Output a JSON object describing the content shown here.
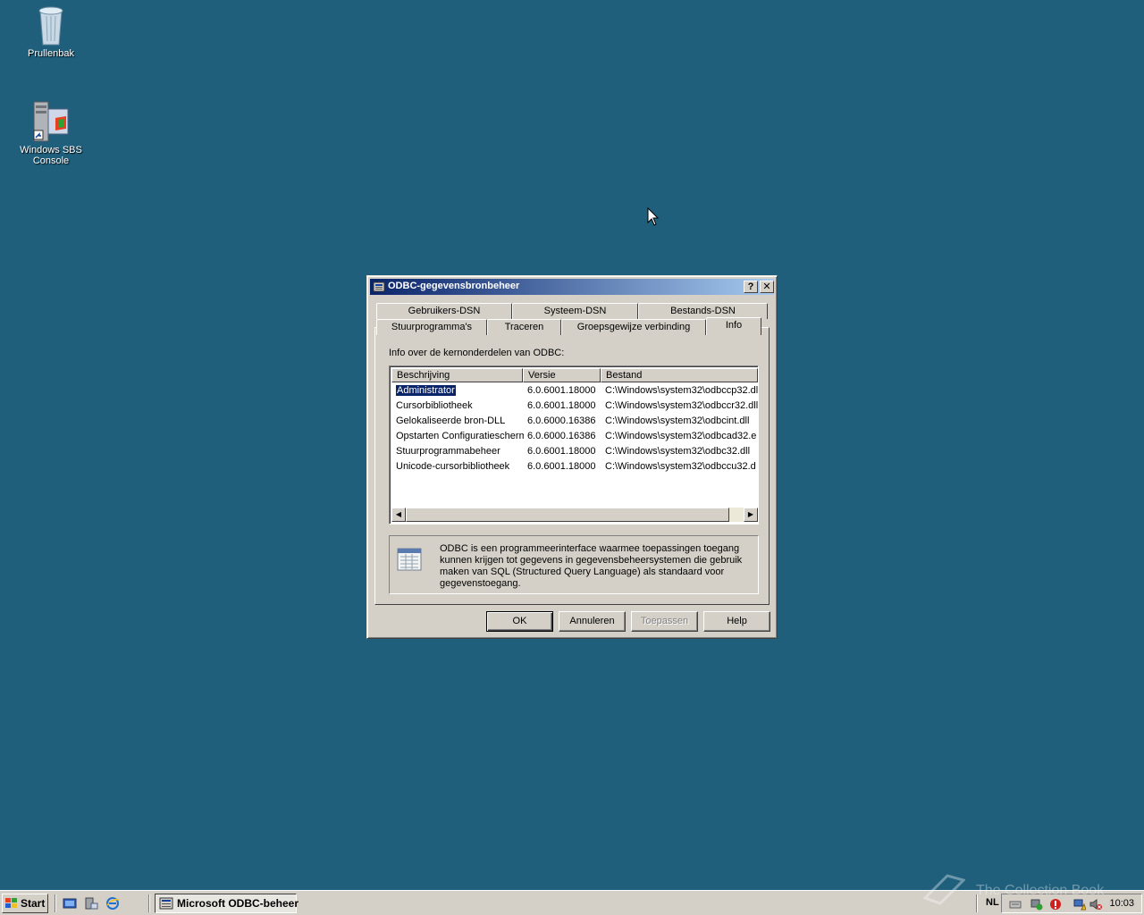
{
  "desktop": {
    "icons": [
      {
        "label": "Prullenbak"
      },
      {
        "label": "Windows SBS Console"
      }
    ]
  },
  "dialog": {
    "title": "ODBC-gegevensbronbeheer",
    "help_btn": "?",
    "close_btn": "✕",
    "tabs_back": [
      "Gebruikers-DSN",
      "Systeem-DSN",
      "Bestands-DSN"
    ],
    "tabs_front": [
      "Stuurprogramma's",
      "Traceren",
      "Groepsgewijze verbinding",
      "Info"
    ],
    "panel_label": "Info over de kernonderdelen van ODBC:",
    "columns": [
      "Beschrijving",
      "Versie",
      "Bestand"
    ],
    "rows": [
      {
        "desc": "Administrator",
        "version": "6.0.6001.18000",
        "file": "C:\\Windows\\system32\\odbccp32.dl"
      },
      {
        "desc": "Cursorbibliotheek",
        "version": "6.0.6001.18000",
        "file": "C:\\Windows\\system32\\odbccr32.dll"
      },
      {
        "desc": "Gelokaliseerde bron-DLL",
        "version": "6.0.6000.16386",
        "file": "C:\\Windows\\system32\\odbcint.dll"
      },
      {
        "desc": "Opstarten Configuratiescherm",
        "version": "6.0.6000.16386",
        "file": "C:\\Windows\\system32\\odbcad32.e"
      },
      {
        "desc": "Stuurprogrammabeheer",
        "version": "6.0.6001.18000",
        "file": "C:\\Windows\\system32\\odbc32.dll"
      },
      {
        "desc": "Unicode-cursorbibliotheek",
        "version": "6.0.6001.18000",
        "file": "C:\\Windows\\system32\\odbccu32.d"
      }
    ],
    "description": "ODBC is een programmeerinterface waarmee toepassingen toegang kunnen krijgen tot gegevens in gegevensbeheersystemen die gebruik maken van SQL (Structured Query Language) als standaard voor gegevenstoegang.",
    "buttons": {
      "ok": "OK",
      "cancel": "Annuleren",
      "apply": "Toepassen",
      "help": "Help"
    }
  },
  "taskbar": {
    "start": "Start",
    "task": "Microsoft ODBC-beheer",
    "lang": "NL",
    "clock": "10:03"
  },
  "watermark": "The Collection Book"
}
